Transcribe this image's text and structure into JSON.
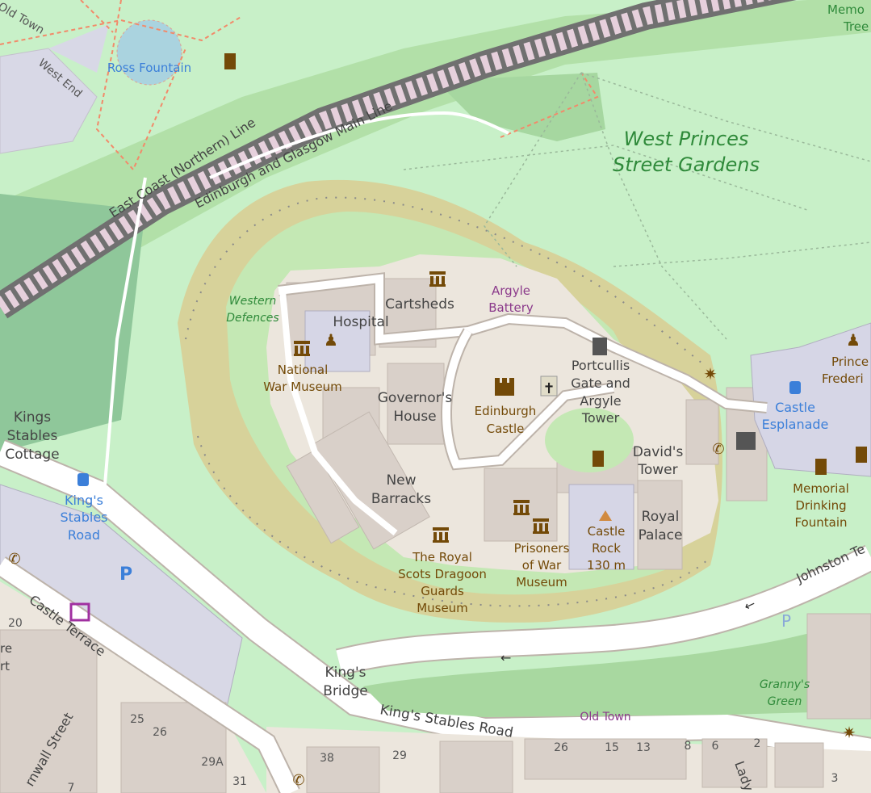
{
  "map": {
    "colors": {
      "park": "#c8f0c8",
      "wood": "#a8d8a0",
      "castle_grounds": "#d7d29a",
      "castle_inner": "#c4e8b4",
      "area_beige": "#ece6dd",
      "building": "#d9d0c9",
      "landmark": "#d6d6e6",
      "road": "#ffffff",
      "road_casing": "#bdb3aa",
      "path": "#f28a6a",
      "railway": "#707070",
      "parking": "#d8d8e6",
      "museum_brown": "#734a08",
      "blue_label": "#3b7fd9",
      "green_label": "#2f8a3a",
      "purple_label": "#8b3a8b",
      "water": "#aad3df"
    },
    "labels": {
      "west_princes": "West Princes",
      "street_gardens": "Street Gardens",
      "ross_fountain": "Ross Fountain",
      "west_end": "West End",
      "old_town_top": "Old Town",
      "memorial": "Memo",
      "trees": "Tree",
      "east_coast_line": "East Coast (Northern) Line",
      "glasgow_line": "Edinburgh and Glasgow Main Line",
      "western": "Western",
      "defences": "Defences",
      "cartsheds": "Cartsheds",
      "argyle": "Argyle",
      "battery": "Battery",
      "hospital": "Hospital",
      "national": "National",
      "war_museum": "War Museum",
      "governors": "Governor's",
      "house": "House",
      "edinburgh": "Edinburgh",
      "castle": "Castle",
      "portcullis": "Portcullis",
      "gate_and": "Gate and",
      "argyle2": "Argyle",
      "tower": "Tower",
      "davids": "David's",
      "tower2": "Tower",
      "new": "New",
      "barracks": "Barracks",
      "royal_scots_1": "The Royal",
      "royal_scots_2": "Scots Dragoon",
      "royal_scots_3": "Guards",
      "royal_scots_4": "Museum",
      "prisoners_1": "Prisoners",
      "prisoners_2": "of War",
      "prisoners_3": "Museum",
      "castle_rock_1": "Castle",
      "castle_rock_2": "Rock",
      "castle_rock_3": "130 m",
      "royal": "Royal",
      "palace": "Palace",
      "prince": "Prince",
      "frederick": "Frederi",
      "castle_esp_1": "Castle",
      "castle_esp_2": "Esplanade",
      "memorial_1": "Memorial",
      "memorial_2": "Drinking",
      "memorial_3": "Fountain",
      "johnston": "Johnston Te",
      "kings_stables_1": "Kings",
      "kings_stables_2": "Stables",
      "kings_stables_3": "Cottage",
      "bus_1": "King's",
      "bus_2": "Stables",
      "bus_3": "Road",
      "castle_terrace": "Castle Terrace",
      "num_20": "20",
      "re": "re",
      "rt": "rt",
      "kings_bridge_1": "King's",
      "kings_bridge_2": "Bridge",
      "kings_stables_road": "King's Stables Road",
      "old_town": "Old Town",
      "grannys_1": "Granny's",
      "grannys_2": "Green",
      "cornwall": "rnwall Street",
      "lady": "Lady",
      "n25": "25",
      "n26": "26",
      "n29a": "29A",
      "n31": "31",
      "n38": "38",
      "n29": "29",
      "n26b": "26",
      "n15": "15",
      "n13": "13",
      "n8": "8",
      "n6": "6",
      "n2": "2",
      "n3": "3",
      "n7": "7"
    }
  }
}
